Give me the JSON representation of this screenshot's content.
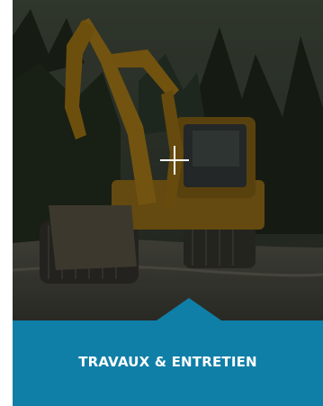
{
  "card": {
    "title": "TRAVAUX & ENTRETIEN",
    "image_subject": "yellow excavator on a gravel site in a forest",
    "overlay_icon": "plus-icon",
    "caption_color": "#0f7fa7"
  }
}
